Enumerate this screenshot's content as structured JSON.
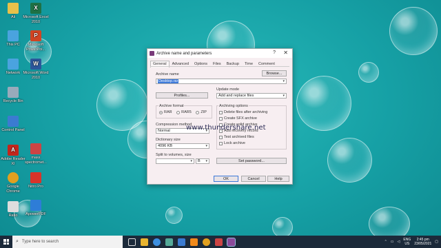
{
  "desktop": {
    "icons": [
      {
        "label": "Ali",
        "icon": "folder-icon",
        "color": "#e8c14a"
      },
      {
        "label": "This PC",
        "icon": "computer-icon",
        "color": "#4aa3df"
      },
      {
        "label": "Network",
        "icon": "network-icon",
        "color": "#4aa3df"
      },
      {
        "label": "Recycle Bin",
        "icon": "recycle-bin-icon",
        "color": "#9ab"
      },
      {
        "label": "Control Panel",
        "icon": "control-panel-icon",
        "color": "#3b7bd1"
      },
      {
        "label": "Adobe Reader XI",
        "icon": "pdf-icon",
        "color": "#c3261c"
      },
      {
        "label": "Google Chrome",
        "icon": "chrome-icon",
        "color": "#e0a020"
      },
      {
        "label": "Ratio",
        "icon": "file-icon",
        "color": "#ddd"
      },
      {
        "label": "Microsoft Excel 2010",
        "icon": "excel-icon",
        "color": "#1e7145"
      },
      {
        "label": "Microsoft PowerPoi...",
        "icon": "powerpoint-icon",
        "color": "#d04423"
      },
      {
        "label": "Microsoft Word 2010",
        "icon": "word-icon",
        "color": "#2b579a"
      },
      {
        "label": "mass spectromet...",
        "icon": "chart-file-icon",
        "color": "#c44"
      },
      {
        "label": "Nitro Pro",
        "icon": "nitro-icon",
        "color": "#d8342a"
      },
      {
        "label": "ApowerPDF",
        "icon": "pdf-app-icon",
        "color": "#2e7dd7"
      }
    ]
  },
  "dialog": {
    "title": "Archive name and parameters",
    "help": "?",
    "close": "✕",
    "tabs": [
      "General",
      "Advanced",
      "Options",
      "Files",
      "Backup",
      "Time",
      "Comment"
    ],
    "archive_name_label": "Archive name",
    "browse_label": "Browse...",
    "archive_name_value": "Desktop.rar",
    "profiles_label": "Profiles...",
    "update_mode_label": "Update mode",
    "update_mode_value": "Add and replace files",
    "archive_format_label": "Archive format",
    "formats": [
      "RAR",
      "RAR5",
      "ZIP"
    ],
    "selected_format": "RAR",
    "archiving_options_label": "Archiving options",
    "options": [
      "Delete files after archiving",
      "Create SFX archive",
      "Create solid archive",
      "Add recovery record",
      "Test archived files",
      "Lock archive"
    ],
    "compression_label": "Compression method",
    "compression_value": "Normal",
    "dictionary_label": "Dictionary size",
    "dictionary_value": "4096 KB",
    "split_label": "Split to volumes, size",
    "split_value": "",
    "split_unit": "B",
    "set_password_label": "Set password...",
    "ok_label": "OK",
    "cancel_label": "Cancel",
    "help_label": "Help"
  },
  "watermark": "www.thundershare.net",
  "taskbar": {
    "search_placeholder": "Type here to search",
    "icons": [
      "task-view-icon",
      "file-explorer-icon",
      "edge-icon",
      "store-icon",
      "mail-icon",
      "vlc-icon",
      "chrome-icon",
      "photos-icon",
      "winrar-icon"
    ],
    "icon_colors": [
      "#ddd",
      "#e8b430",
      "#3c8fe0",
      "#5a9",
      "#3b7bd1",
      "#f08a1c",
      "#e0a020",
      "#c44",
      "#8a4a9a"
    ],
    "lang_top": "ENG",
    "lang_bottom": "US",
    "time": "2:45 pm",
    "date": "23/05/2021"
  }
}
